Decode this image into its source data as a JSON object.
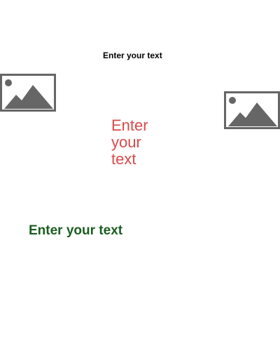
{
  "texts": [
    {
      "content": "Enter your text",
      "color": "#000000"
    },
    {
      "content": "Enter your text",
      "color": "#d94a4a"
    },
    {
      "content": "Enter your text",
      "color": "#1b5e20"
    }
  ],
  "images": [
    {
      "icon": "image-placeholder-icon",
      "color": "#666666"
    },
    {
      "icon": "image-placeholder-icon",
      "color": "#666666"
    }
  ]
}
